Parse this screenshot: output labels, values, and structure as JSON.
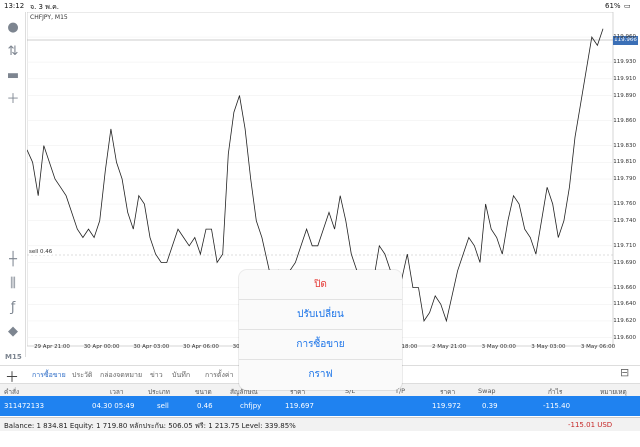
{
  "status_bar": {
    "time": "13:12",
    "date": "จ. 3 พ.ค.",
    "battery": "61%"
  },
  "chart": {
    "symbol_title": "CHFJPY, M15",
    "current_price": "119.966",
    "sell_label": "sell 0.46"
  },
  "chart_data": {
    "type": "line",
    "series": [
      {
        "values": [
          119.825,
          119.81,
          119.77,
          119.83,
          119.81,
          119.79,
          119.78,
          119.77,
          119.75,
          119.73,
          119.72,
          119.73,
          119.72,
          119.74,
          119.8,
          119.85,
          119.81,
          119.79,
          119.75,
          119.73,
          119.77,
          119.76,
          119.72,
          119.7,
          119.69,
          119.69,
          119.71,
          119.73,
          119.72,
          119.71,
          119.72,
          119.7,
          119.73,
          119.73,
          119.69,
          119.7,
          119.82,
          119.87,
          119.89,
          119.85,
          119.79,
          119.74,
          119.72,
          119.69,
          119.66,
          119.68,
          119.66,
          119.68,
          119.69,
          119.71,
          119.73,
          119.71,
          119.71,
          119.73,
          119.75,
          119.73,
          119.77,
          119.74,
          119.7,
          119.68,
          119.66,
          119.64,
          119.67,
          119.71,
          119.7,
          119.68,
          119.67,
          119.67,
          119.7,
          119.66,
          119.66,
          119.62,
          119.63,
          119.65,
          119.64,
          119.62,
          119.65,
          119.68,
          119.7,
          119.72,
          119.71,
          119.69,
          119.76,
          119.73,
          119.72,
          119.7,
          119.74,
          119.77,
          119.76,
          119.73,
          119.72,
          119.7,
          119.74,
          119.78,
          119.76,
          119.72,
          119.74,
          119.78,
          119.84,
          119.88,
          119.92,
          119.96,
          119.95,
          119.97
        ]
      }
    ],
    "y_ticks": [
      "119.960",
      "119.930",
      "119.910",
      "119.890",
      "119.860",
      "119.830",
      "119.810",
      "119.790",
      "119.760",
      "119.740",
      "119.710",
      "119.690",
      "119.660",
      "119.640",
      "119.620",
      "119.600"
    ],
    "x_ticks": [
      "29 Apr 21:00",
      "30 Apr 00:00",
      "30 Apr 03:00",
      "30 Apr 06:00",
      "30 Apr 09:00",
      "30 Apr 12:00",
      "30 Apr 15:00",
      "30 Apr 18:00",
      "2 May 21:00",
      "3 May 00:00",
      "3 May 03:00",
      "3 May 06:00"
    ],
    "ylim": [
      119.59,
      119.99
    ]
  },
  "toolbar": {
    "icons": [
      "user-icon",
      "trade-icon",
      "chat-icon",
      "new-order-icon",
      "crosshair-icon",
      "candles-icon",
      "function-icon",
      "objects-icon"
    ],
    "timeframe": "M15"
  },
  "tabs": [
    "การซื้อขาย",
    "ประวัติ",
    "กล่องจดหมาย",
    "ข่าว",
    "บันทึก",
    "การตั้งค่า"
  ],
  "columns": [
    "คำสั่ง",
    "เวลา",
    "ประเภท",
    "ขนาด",
    "สัญลักษณ์",
    "ราคา",
    "S/L",
    "T/P",
    "ราคา",
    "Swap",
    "กำไร",
    "หมายเหตุ"
  ],
  "trade_row": {
    "order": "311472133",
    "time": "04.30 05:49",
    "type": "sell",
    "size": "0.46",
    "symbol": "chfjpy",
    "open_price": "119.697",
    "current_price": "119.972",
    "swap": "0.39",
    "profit": "-115.40"
  },
  "balance_line": "Balance: 1 834.81 Equity: 1 719.80 หลักประกัน: 506.05 ฟรี: 1 213.75 Level: 339.85%",
  "total_profit": "-115.01  USD",
  "context_menu": {
    "close": "ปิด",
    "modify": "ปรับเปลี่ยน",
    "trade": "การซื้อขาย",
    "chart": "กราฟ"
  }
}
